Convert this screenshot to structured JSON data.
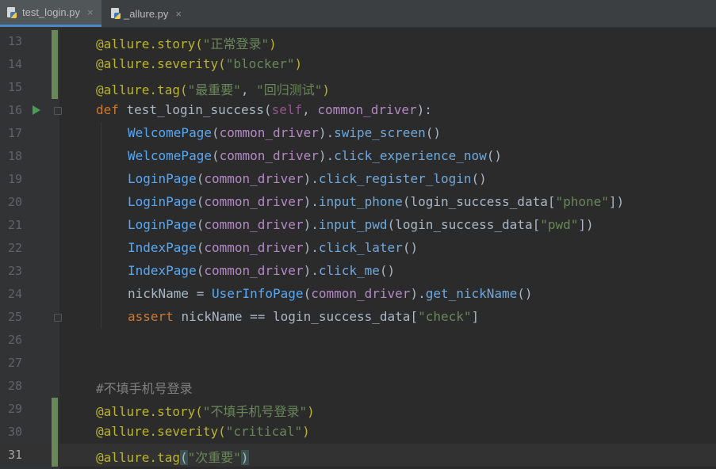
{
  "tabs": [
    {
      "label": "test_login.py",
      "active": true,
      "close": "×"
    },
    {
      "label": "_allure.py",
      "active": false,
      "close": "×"
    }
  ],
  "editor": {
    "lines": [
      {
        "num": "13",
        "tokens": [
          [
            "deco",
            "@allure.story("
          ],
          [
            "str",
            "\"正常登录\""
          ],
          [
            "deco",
            ")"
          ]
        ]
      },
      {
        "num": "14",
        "tokens": [
          [
            "deco",
            "@allure.severity("
          ],
          [
            "str",
            "\"blocker\""
          ],
          [
            "deco",
            ")"
          ]
        ]
      },
      {
        "num": "15",
        "tokens": [
          [
            "deco",
            "@allure.tag("
          ],
          [
            "str",
            "\"最重要\""
          ],
          [
            "paren",
            ", "
          ],
          [
            "str",
            "\"回归测试\""
          ],
          [
            "deco",
            ")"
          ]
        ]
      },
      {
        "num": "16",
        "tokens": [
          [
            "kw",
            "def "
          ],
          [
            "fn",
            "test_login_success"
          ],
          [
            "paren",
            "("
          ],
          [
            "self",
            "self"
          ],
          [
            "paren",
            ", "
          ],
          [
            "param",
            "common_driver"
          ],
          [
            "paren",
            "):"
          ]
        ]
      },
      {
        "num": "17",
        "tokens": [
          [
            "cls",
            "WelcomePage"
          ],
          [
            "paren",
            "("
          ],
          [
            "param",
            "common_driver"
          ],
          [
            "paren",
            ")."
          ],
          [
            "meth",
            "swipe_screen"
          ],
          [
            "paren",
            "()"
          ]
        ]
      },
      {
        "num": "18",
        "tokens": [
          [
            "cls",
            "WelcomePage"
          ],
          [
            "paren",
            "("
          ],
          [
            "param",
            "common_driver"
          ],
          [
            "paren",
            ")."
          ],
          [
            "meth",
            "click_experience_now"
          ],
          [
            "paren",
            "()"
          ]
        ]
      },
      {
        "num": "19",
        "tokens": [
          [
            "cls",
            "LoginPage"
          ],
          [
            "paren",
            "("
          ],
          [
            "param",
            "common_driver"
          ],
          [
            "paren",
            ")."
          ],
          [
            "meth",
            "click_register_login"
          ],
          [
            "paren",
            "()"
          ]
        ]
      },
      {
        "num": "20",
        "tokens": [
          [
            "cls",
            "LoginPage"
          ],
          [
            "paren",
            "("
          ],
          [
            "param",
            "common_driver"
          ],
          [
            "paren",
            ")."
          ],
          [
            "meth",
            "input_phone"
          ],
          [
            "paren",
            "(login_success_data["
          ],
          [
            "str",
            "\"phone\""
          ],
          [
            "paren",
            "])"
          ]
        ]
      },
      {
        "num": "21",
        "tokens": [
          [
            "cls",
            "LoginPage"
          ],
          [
            "paren",
            "("
          ],
          [
            "param",
            "common_driver"
          ],
          [
            "paren",
            ")."
          ],
          [
            "meth",
            "input_pwd"
          ],
          [
            "paren",
            "(login_success_data["
          ],
          [
            "str",
            "\"pwd\""
          ],
          [
            "paren",
            "])"
          ]
        ]
      },
      {
        "num": "22",
        "tokens": [
          [
            "cls",
            "IndexPage"
          ],
          [
            "paren",
            "("
          ],
          [
            "param",
            "common_driver"
          ],
          [
            "paren",
            ")."
          ],
          [
            "meth",
            "click_later"
          ],
          [
            "paren",
            "()"
          ]
        ]
      },
      {
        "num": "23",
        "tokens": [
          [
            "cls",
            "IndexPage"
          ],
          [
            "paren",
            "("
          ],
          [
            "param",
            "common_driver"
          ],
          [
            "paren",
            ")."
          ],
          [
            "meth",
            "click_me"
          ],
          [
            "paren",
            "()"
          ]
        ]
      },
      {
        "num": "24",
        "tokens": [
          [
            "paren",
            "nickName = "
          ],
          [
            "cls",
            "UserInfoPage"
          ],
          [
            "paren",
            "("
          ],
          [
            "param",
            "common_driver"
          ],
          [
            "paren",
            ")."
          ],
          [
            "meth",
            "get_nickName"
          ],
          [
            "paren",
            "()"
          ]
        ]
      },
      {
        "num": "25",
        "tokens": [
          [
            "kw",
            "assert "
          ],
          [
            "paren",
            "nickName == login_success_data["
          ],
          [
            "str",
            "\"check\""
          ],
          [
            "paren",
            "]"
          ]
        ]
      },
      {
        "num": "26",
        "tokens": []
      },
      {
        "num": "27",
        "tokens": []
      },
      {
        "num": "28",
        "tokens": [
          [
            "cmt",
            "#不填手机号登录"
          ]
        ]
      },
      {
        "num": "29",
        "tokens": [
          [
            "deco",
            "@allure.story("
          ],
          [
            "str",
            "\"不填手机号登录\""
          ],
          [
            "deco",
            ")"
          ]
        ]
      },
      {
        "num": "30",
        "tokens": [
          [
            "deco",
            "@allure.severity("
          ],
          [
            "str",
            "\"critical\""
          ],
          [
            "deco",
            ")"
          ]
        ]
      },
      {
        "num": "31",
        "tokens": [
          [
            "deco",
            "@allure.tag"
          ],
          [
            "match",
            "("
          ],
          [
            "str",
            "\"次重要\""
          ],
          [
            "match",
            ")"
          ]
        ]
      }
    ]
  },
  "colors": {
    "background": "#2b2b2b",
    "gutter": "#313335",
    "decorator": "#bbb529",
    "string": "#6a8759",
    "keyword": "#cc7832",
    "class": "#56a8f5",
    "param": "#b389c5",
    "comment": "#808080",
    "change_marker": "#6a8759",
    "run_icon": "#499c54"
  },
  "icons": {
    "run": "run-gutter-icon",
    "fold": "fold-marker-icon",
    "python": "python-file-icon"
  }
}
